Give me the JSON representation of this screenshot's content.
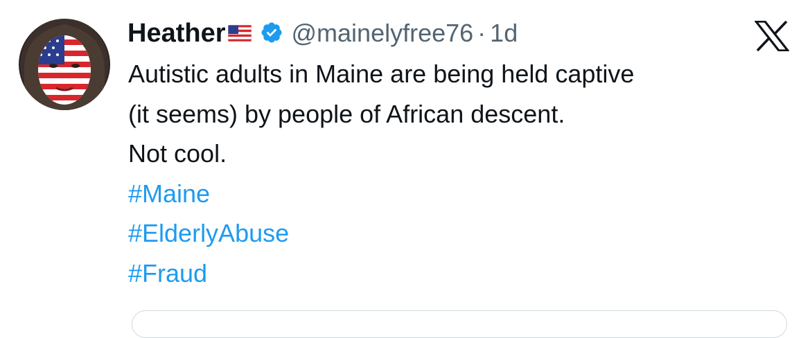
{
  "tweet": {
    "author": {
      "display_name": "Heather",
      "flag_emoji": "us-flag-icon",
      "verified_icon": "verified-badge-icon",
      "handle": "@mainelyfree76",
      "separator": "·",
      "time": "1d"
    },
    "body_lines": [
      "Autistic adults in Maine are being held captive",
      "(it seems) by people of African descent.",
      "Not cool."
    ],
    "hashtags": [
      "#Maine",
      "#ElderlyAbuse",
      "#Fraud"
    ],
    "platform_logo": "x-logo-icon"
  },
  "colors": {
    "text": "#0f1419",
    "muted": "#536471",
    "link": "#1d9bf0",
    "verified": "#1d9bf0",
    "border": "#cfd9de"
  }
}
